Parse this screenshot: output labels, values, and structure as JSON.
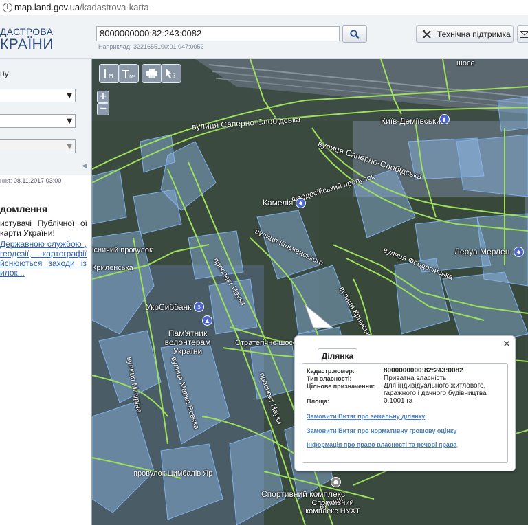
{
  "browser": {
    "url_host": "map.land.gov.ua",
    "url_path": "/kadastrova-karta"
  },
  "header": {
    "brand_line1": "ДАСТРОВА",
    "brand_line2": "КРАЇНИ",
    "search_value": "8000000000:82:243:0082",
    "example_text": "Наприклад: 3221655100:01:047:0052",
    "support_label": "Технічна підтримка"
  },
  "sidebar": {
    "top_label": "ну",
    "updated_text": "ння: 08.11.2017 03:00",
    "notice_title": "домлення",
    "notice_text": "истувачі Публічної ої карти України!",
    "notice_link": "Державною службою , геодезії, картографії йснюються заходи із илок..."
  },
  "map": {
    "labels": {
      "street_saperno": "вулиця Саперно-Слобідська",
      "street_saperno2": "вулиця Саперно-Слобідська",
      "kyiv_demiivskyi": "Київ-Деміївський",
      "feodosiiskyi_provulok": "Феодосійський провулок",
      "kamelia": "Камелія",
      "street_kilchena": "вулиця Кільченського",
      "street_feodosiiska": "вулиця Феодосійська",
      "leroy_merlin": "Леруа Мерлен",
      "ukrsibbank": "УкрСиббанк",
      "prospekt_nauky": "проспект Науки",
      "monument": "Пам'ятник волонтерам України",
      "strategichne": "Стратегічне шосе",
      "street_kryvonosa": "вулиця Кримська",
      "street_makovska": "вулиця Марка Вовчка",
      "prospekt_nauky2": "проспект Науки",
      "sport": "Спортивний комплекс",
      "sport2": "Спортивний комплекс НУХТ",
      "street_mychurina": "вулиця Мічуріна",
      "krylenska": "Криленська",
      "sadovyi": "існичий провулок",
      "provulok_tsymb": "провулок Цимбалів Яр",
      "street_shose": "шосе",
      "street_kryvonosa2": "вулиця"
    },
    "popup": {
      "tab_label": "Ділянка",
      "rows": [
        {
          "key": "Кадастр.номер:",
          "value": "8000000000:82:243:0082"
        },
        {
          "key": "Тип власності:",
          "value": "Приватна власність"
        },
        {
          "key": "Цільове призначення:",
          "value": "Для індивідуального житлового, гаражного і дачного будівництва"
        },
        {
          "key": "Площа:",
          "value": "0.1001 га"
        }
      ],
      "links": [
        "Замовити Витяг про земельну ділянку",
        "Замовити Витяг про нормативну грошову оцінку",
        "Інформація про право власності та речові права"
      ]
    }
  }
}
